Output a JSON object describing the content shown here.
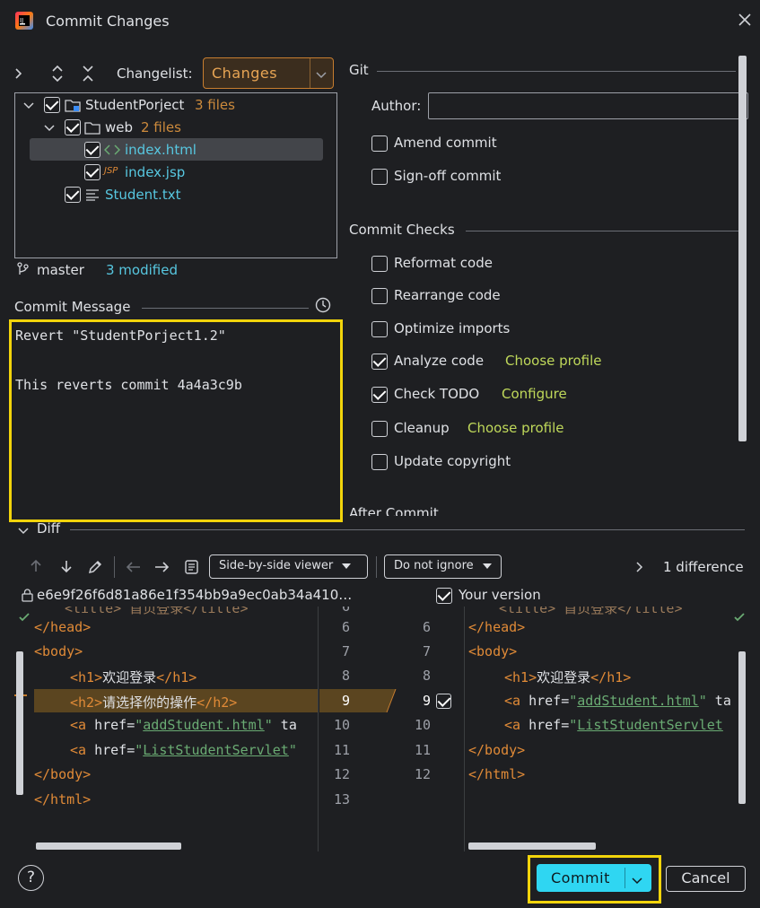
{
  "window": {
    "title": "Commit Changes"
  },
  "changes": {
    "changelist_label": "Changelist:",
    "changelist_value": "Changes",
    "tree": [
      {
        "name": "StudentPorject",
        "extra": "3 files"
      },
      {
        "name": "web",
        "extra": "2 files"
      },
      {
        "name": "index.html",
        "extra": ""
      },
      {
        "name": "index.jsp",
        "extra": ""
      },
      {
        "name": "Student.txt",
        "extra": ""
      }
    ],
    "branch": "master",
    "modified": "3 modified"
  },
  "commit_message": {
    "label": "Commit Message",
    "line1": "Revert \"StudentPorject1.2\"",
    "line2": "This reverts commit 4a4a3c9b"
  },
  "git": {
    "section_title": "Git",
    "author_label": "Author:",
    "author_value": "",
    "amend": "Amend commit",
    "signoff": "Sign-off commit"
  },
  "checks": {
    "section_title": "Commit Checks",
    "reformat": "Reformat code",
    "rearrange": "Rearrange code",
    "optimize": "Optimize imports",
    "analyze": "Analyze code",
    "analyze_link": "Choose profile",
    "todo": "Check TODO",
    "todo_link": "Configure",
    "cleanup": "Cleanup",
    "cleanup_link": "Choose profile",
    "copyright": "Update copyright",
    "after_commit": "After Commit"
  },
  "diff": {
    "label": "Diff",
    "viewer": "Side-by-side viewer",
    "ignore": "Do not ignore",
    "differences": "1 difference",
    "left_hash": "e6e9f26f6d81a86e1f354bb9a9ec0ab34a410…",
    "right_label": "Your version",
    "left_lines": {
      "l6": "</head>",
      "l7": "<body>",
      "l8_tag1": "<h1>",
      "l8_text": "欢迎登录",
      "l8_tag2": "</h1>",
      "l9_tag1": "<h2>",
      "l9_text": "请选择你的操作",
      "l9_tag2": "</h2>",
      "l10_tag": "<a",
      "l10_attr": " href=",
      "l10_q1": "\"",
      "l10_val": "addStudent.html",
      "l10_q2": "\"",
      "l10_rest": " ta",
      "l11_tag": "<a",
      "l11_attr": " href=",
      "l11_q1": "\"",
      "l11_val": "ListStudentServlet",
      "l11_q2": "\"",
      "l12": "</body>",
      "l13": "</html>"
    },
    "right_lines": {
      "r6": "</head>",
      "r7": "<body>",
      "r8_tag1": "<h1>",
      "r8_text": "欢迎登录",
      "r8_tag2": "</h1>",
      "r9_tag": "<a",
      "r9_attr": " href=",
      "r9_q1": "\"",
      "r9_val": "addStudent.html",
      "r9_q2": "\"",
      "r9_rest": " ta",
      "r10_tag": "<a",
      "r10_attr": " href=",
      "r10_q1": "\"",
      "r10_val": "ListStudentServlet",
      "r11": "</body>",
      "r12": "</html>"
    },
    "left_numbers": [
      "6",
      "7",
      "8",
      "9",
      "10",
      "11",
      "12",
      "13"
    ],
    "right_numbers": [
      "6",
      "7",
      "8",
      "9",
      "10",
      "11",
      "12"
    ]
  },
  "footer": {
    "help": "?",
    "commit": "Commit",
    "cancel": "Cancel"
  }
}
